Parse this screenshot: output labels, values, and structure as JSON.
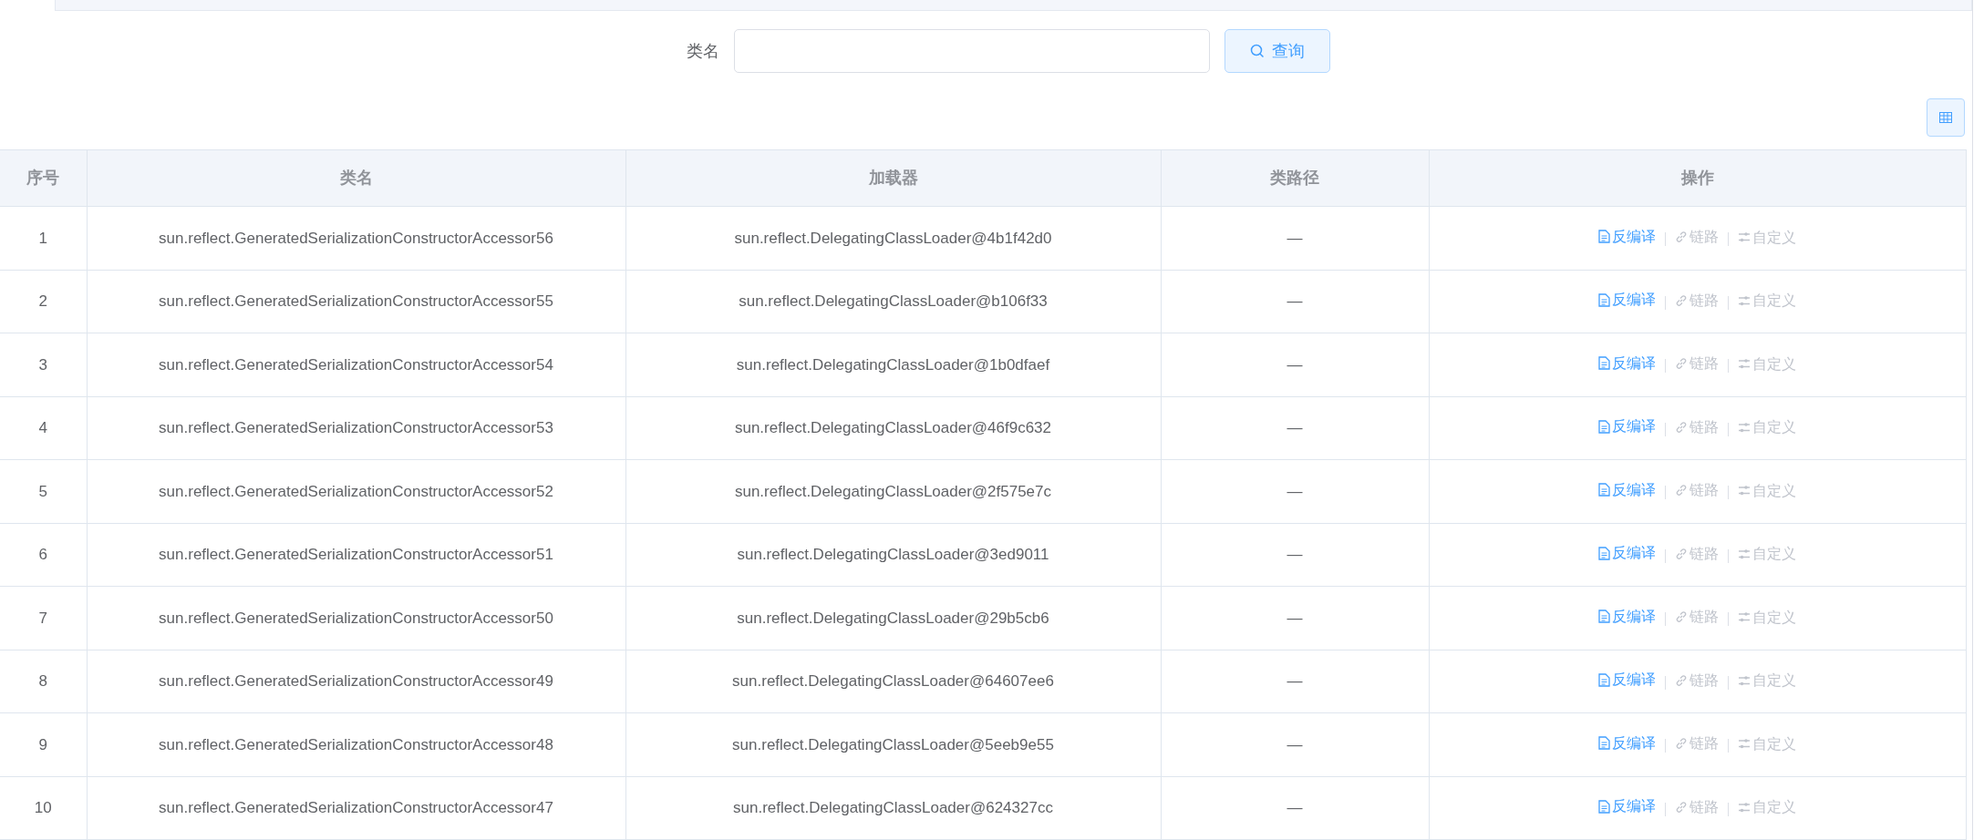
{
  "search": {
    "label": "类名",
    "button": "查询"
  },
  "table": {
    "columns": [
      "序号",
      "类名",
      "加载器",
      "类路径",
      "操作"
    ],
    "rows": [
      {
        "index": "1",
        "class_name": "sun.reflect.GeneratedSerializationConstructorAccessor56",
        "loader": "sun.reflect.DelegatingClassLoader@4b1f42d0",
        "class_path": "—",
        "actions": [
          {
            "kind": "decompile",
            "label": "反编译",
            "disabled": false
          },
          {
            "kind": "link",
            "label": "链路",
            "disabled": true
          },
          {
            "kind": "custom",
            "label": "自定义",
            "disabled": true
          }
        ]
      },
      {
        "index": "2",
        "class_name": "sun.reflect.GeneratedSerializationConstructorAccessor55",
        "loader": "sun.reflect.DelegatingClassLoader@b106f33",
        "class_path": "—",
        "actions": [
          {
            "kind": "decompile",
            "label": "反编译",
            "disabled": false
          },
          {
            "kind": "link",
            "label": "链路",
            "disabled": true
          },
          {
            "kind": "custom",
            "label": "自定义",
            "disabled": true
          }
        ]
      },
      {
        "index": "3",
        "class_name": "sun.reflect.GeneratedSerializationConstructorAccessor54",
        "loader": "sun.reflect.DelegatingClassLoader@1b0dfaef",
        "class_path": "—",
        "actions": [
          {
            "kind": "decompile",
            "label": "反编译",
            "disabled": false
          },
          {
            "kind": "link",
            "label": "链路",
            "disabled": true
          },
          {
            "kind": "custom",
            "label": "自定义",
            "disabled": true
          }
        ]
      },
      {
        "index": "4",
        "class_name": "sun.reflect.GeneratedSerializationConstructorAccessor53",
        "loader": "sun.reflect.DelegatingClassLoader@46f9c632",
        "class_path": "—",
        "actions": [
          {
            "kind": "decompile",
            "label": "反编译",
            "disabled": false
          },
          {
            "kind": "link",
            "label": "链路",
            "disabled": true
          },
          {
            "kind": "custom",
            "label": "自定义",
            "disabled": true
          }
        ]
      },
      {
        "index": "5",
        "class_name": "sun.reflect.GeneratedSerializationConstructorAccessor52",
        "loader": "sun.reflect.DelegatingClassLoader@2f575e7c",
        "class_path": "—",
        "actions": [
          {
            "kind": "decompile",
            "label": "反编译",
            "disabled": false
          },
          {
            "kind": "link",
            "label": "链路",
            "disabled": true
          },
          {
            "kind": "custom",
            "label": "自定义",
            "disabled": true
          }
        ]
      },
      {
        "index": "6",
        "class_name": "sun.reflect.GeneratedSerializationConstructorAccessor51",
        "loader": "sun.reflect.DelegatingClassLoader@3ed9011",
        "class_path": "—",
        "actions": [
          {
            "kind": "decompile",
            "label": "反编译",
            "disabled": false
          },
          {
            "kind": "link",
            "label": "链路",
            "disabled": true
          },
          {
            "kind": "custom",
            "label": "自定义",
            "disabled": true
          }
        ]
      },
      {
        "index": "7",
        "class_name": "sun.reflect.GeneratedSerializationConstructorAccessor50",
        "loader": "sun.reflect.DelegatingClassLoader@29b5cb6",
        "class_path": "—",
        "actions": [
          {
            "kind": "decompile",
            "label": "反编译",
            "disabled": false
          },
          {
            "kind": "link",
            "label": "链路",
            "disabled": true
          },
          {
            "kind": "custom",
            "label": "自定义",
            "disabled": true
          }
        ]
      },
      {
        "index": "8",
        "class_name": "sun.reflect.GeneratedSerializationConstructorAccessor49",
        "loader": "sun.reflect.DelegatingClassLoader@64607ee6",
        "class_path": "—",
        "actions": [
          {
            "kind": "decompile",
            "label": "反编译",
            "disabled": false
          },
          {
            "kind": "link",
            "label": "链路",
            "disabled": true
          },
          {
            "kind": "custom",
            "label": "自定义",
            "disabled": true
          }
        ]
      },
      {
        "index": "9",
        "class_name": "sun.reflect.GeneratedSerializationConstructorAccessor48",
        "loader": "sun.reflect.DelegatingClassLoader@5eeb9e55",
        "class_path": "—",
        "actions": [
          {
            "kind": "decompile",
            "label": "反编译",
            "disabled": false
          },
          {
            "kind": "link",
            "label": "链路",
            "disabled": true
          },
          {
            "kind": "custom",
            "label": "自定义",
            "disabled": true
          }
        ]
      },
      {
        "index": "10",
        "class_name": "sun.reflect.GeneratedSerializationConstructorAccessor47",
        "loader": "sun.reflect.DelegatingClassLoader@624327cc",
        "class_path": "—",
        "actions": [
          {
            "kind": "decompile",
            "label": "反编译",
            "disabled": false
          },
          {
            "kind": "link",
            "label": "链路",
            "disabled": true
          },
          {
            "kind": "custom",
            "label": "自定义",
            "disabled": true
          }
        ]
      }
    ]
  }
}
